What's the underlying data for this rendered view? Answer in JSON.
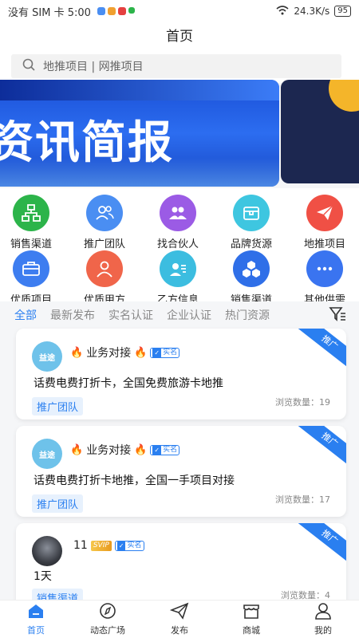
{
  "status": {
    "carrier": "没有 SIM 卡 5:00",
    "speed": "24.3K/s",
    "battery": "95"
  },
  "header": {
    "title": "首页"
  },
  "search": {
    "placeholder": "地推项目 | 网推项目"
  },
  "banner": {
    "title": "资讯简报"
  },
  "grid": [
    {
      "label": "销售渠道",
      "color": "#2cb44a",
      "icon": "network-icon"
    },
    {
      "label": "推广团队",
      "color": "#4a8ef2",
      "icon": "group-icon"
    },
    {
      "label": "找合伙人",
      "color": "#9b5be5",
      "icon": "partner-icon"
    },
    {
      "label": "品牌货源",
      "color": "#3ec6e0",
      "icon": "box-icon"
    },
    {
      "label": "地推项目",
      "color": "#f05045",
      "icon": "paper-plane-icon"
    },
    {
      "label": "优质项目",
      "color": "#3d7df0",
      "icon": "briefcase-icon"
    },
    {
      "label": "优质甲方",
      "color": "#f0654a",
      "icon": "person-icon"
    },
    {
      "label": "乙方信息",
      "color": "#3cbde0",
      "icon": "contact-icon"
    },
    {
      "label": "销售渠道",
      "color": "#2f6fe8",
      "icon": "cubes-icon"
    },
    {
      "label": "其他供需",
      "color": "#3a74f0",
      "icon": "more-icon"
    }
  ],
  "tabs": [
    "全部",
    "最新发布",
    "实名认证",
    "企业认证",
    "热门资源"
  ],
  "cards": [
    {
      "ribbon": "推广",
      "avatar_text": "益途",
      "name": "业务对接",
      "verified": "实名",
      "body": "话费电费打折卡，全国免费旅游卡地推",
      "tag": "推广团队",
      "views": "浏览数量：19"
    },
    {
      "ribbon": "推广",
      "avatar_text": "益途",
      "name": "业务对接",
      "verified": "实名",
      "body": "话费电费打折卡地推，全国一手项目对接",
      "tag": "推广团队",
      "views": "浏览数量：17"
    },
    {
      "ribbon": "推广",
      "name": "11",
      "svip": "SVIP",
      "verified": "实名",
      "body": "1天",
      "tag": "销售渠道",
      "views": "浏览数量：4"
    }
  ],
  "nav": [
    {
      "label": "首页",
      "icon": "home-icon"
    },
    {
      "label": "动态广场",
      "icon": "compass-icon"
    },
    {
      "label": "发布",
      "icon": "send-icon"
    },
    {
      "label": "商城",
      "icon": "shop-icon"
    },
    {
      "label": "我的",
      "icon": "user-icon"
    }
  ]
}
